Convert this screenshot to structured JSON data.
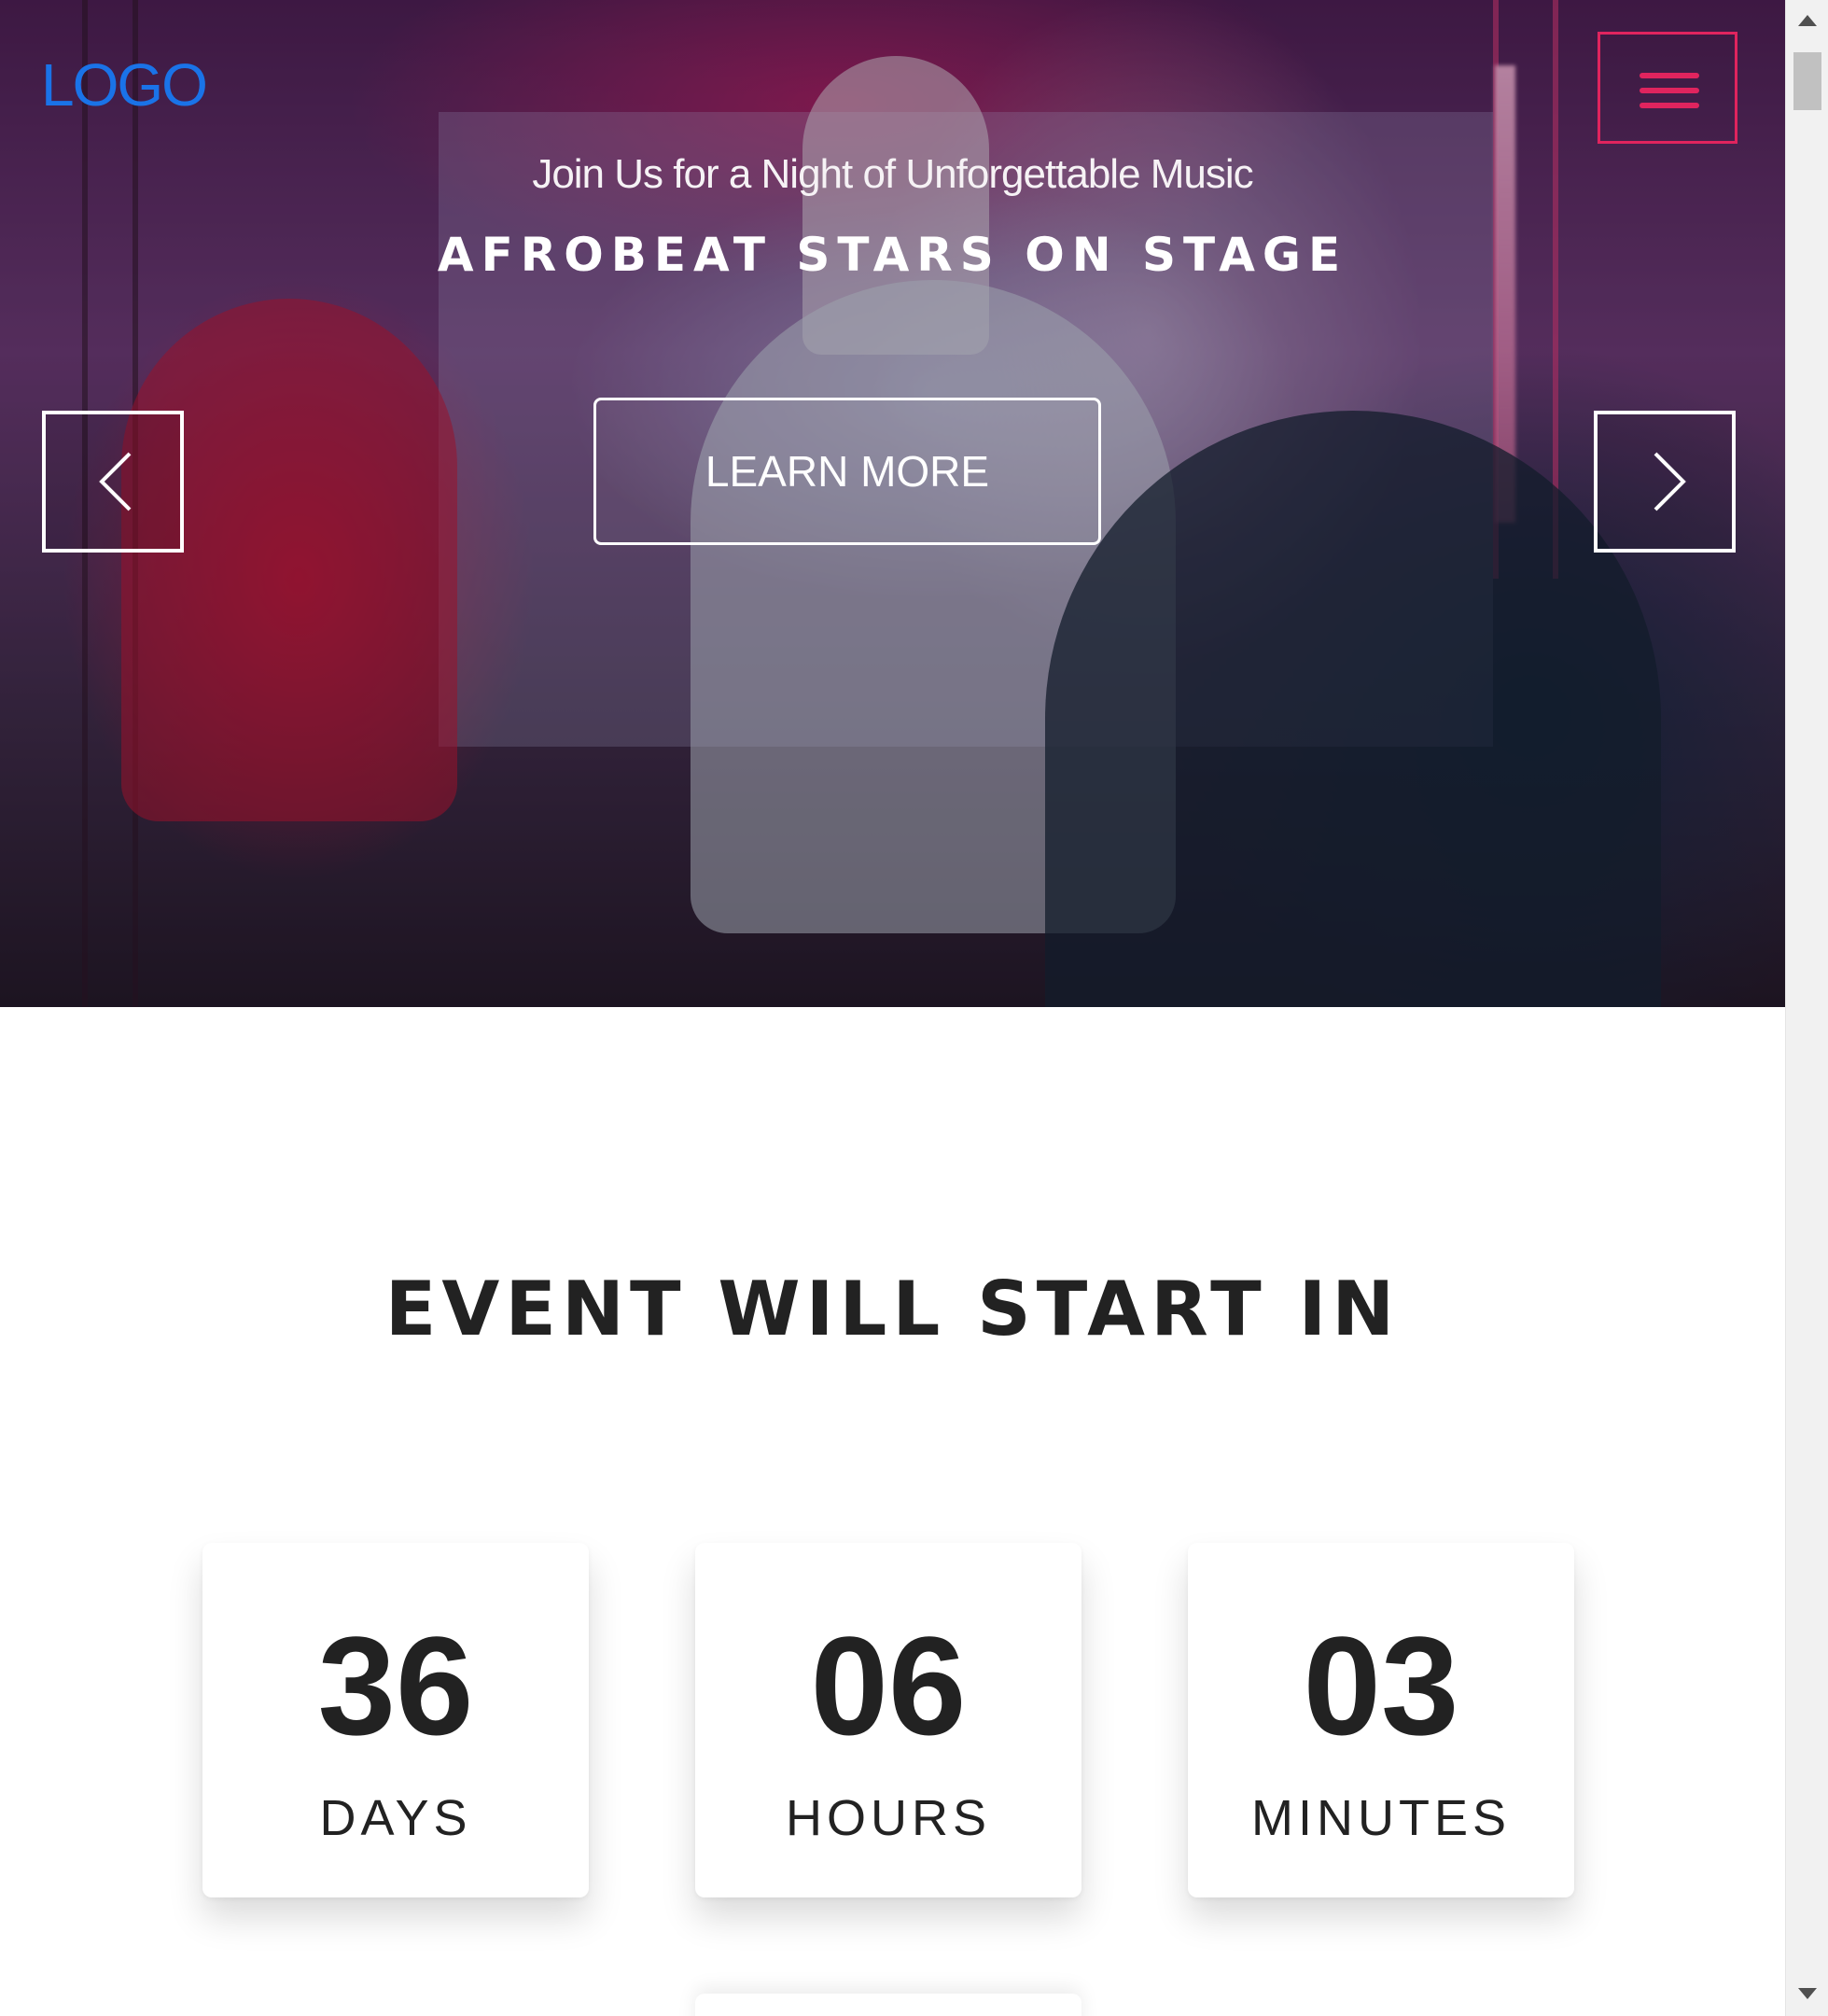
{
  "header": {
    "logo_text": "LOGO",
    "menu_icon": "hamburger-icon",
    "accent_color": "#e0245e",
    "logo_color": "#1a73e8"
  },
  "hero": {
    "subtitle": "Join Us for a Night of Unforgettable Music",
    "title": "AFROBEAT STARS ON STAGE",
    "cta_label": "LEARN MORE",
    "prev_icon": "chevron-left-icon",
    "next_icon": "chevron-right-icon"
  },
  "countdown": {
    "heading": "EVENT WILL START IN",
    "items": [
      {
        "value": "36",
        "unit": "DAYS"
      },
      {
        "value": "06",
        "unit": "HOURS"
      },
      {
        "value": "03",
        "unit": "MINUTES"
      }
    ]
  }
}
